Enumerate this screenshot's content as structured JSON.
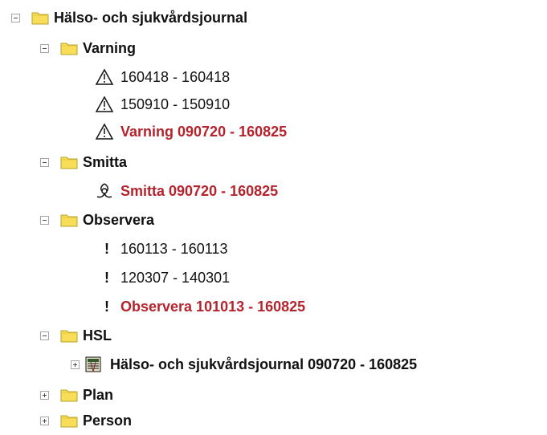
{
  "root": {
    "label": "Hälso- och sjukvårdsjournal",
    "expanded": true,
    "folders": [
      {
        "label": "Varning",
        "expanded": true,
        "items": [
          {
            "text": "160418 - 160418",
            "icon": "warning-icon",
            "highlight": false
          },
          {
            "text": "150910 - 150910",
            "icon": "warning-icon",
            "highlight": false
          },
          {
            "text": "Varning 090720 - 160825",
            "icon": "warning-icon",
            "highlight": true
          }
        ]
      },
      {
        "label": "Smitta",
        "expanded": true,
        "items": [
          {
            "text": "Smitta 090720 - 160825",
            "icon": "biohazard-icon",
            "highlight": true
          }
        ]
      },
      {
        "label": "Observera",
        "expanded": true,
        "items": [
          {
            "text": "160113 - 160113",
            "icon": "exclamation-icon",
            "glyph": "!",
            "highlight": false
          },
          {
            "text": "120307 - 140301",
            "icon": "exclamation-icon",
            "glyph": "!",
            "highlight": false
          },
          {
            "text": "Observera 101013 - 160825",
            "icon": "exclamation-icon",
            "glyph": "!",
            "highlight": true
          }
        ]
      },
      {
        "label": "HSL",
        "expanded": true,
        "items": [
          {
            "text": "Hälso- och sjukvårdsjournal 090720 - 160825",
            "icon": "journal-icon",
            "highlight": false,
            "expandable": true,
            "expanded": false
          }
        ]
      },
      {
        "label": "Plan",
        "expanded": false,
        "items": []
      },
      {
        "label": "Person",
        "expanded": false,
        "items": []
      }
    ]
  },
  "colors": {
    "highlight_text": "#b5232d",
    "folder_fill": "#f7dd58",
    "folder_border": "#b7a12c",
    "expander_border": "#a5a5a5"
  }
}
